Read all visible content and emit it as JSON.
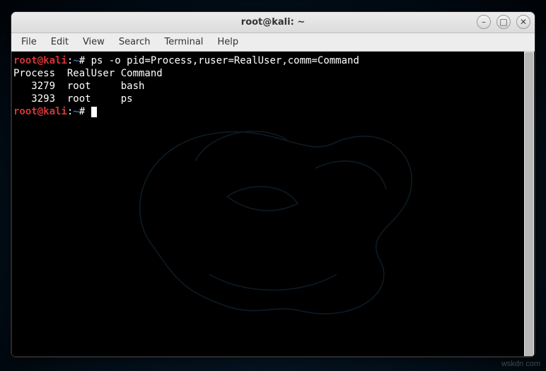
{
  "window": {
    "title": "root@kali: ~"
  },
  "menubar": {
    "items": [
      "File",
      "Edit",
      "View",
      "Search",
      "Terminal",
      "Help"
    ]
  },
  "prompt": {
    "user_host": "root@kali",
    "sep1": ":",
    "path": "~",
    "sep2": "# "
  },
  "commands": {
    "cmd1": "ps -o pid=Process,ruser=RealUser,comm=Command"
  },
  "output": {
    "header": "Process  RealUser Command",
    "row1": "   3279  root     bash",
    "row2": "   3293  root     ps"
  },
  "watermark": "wskdn com"
}
